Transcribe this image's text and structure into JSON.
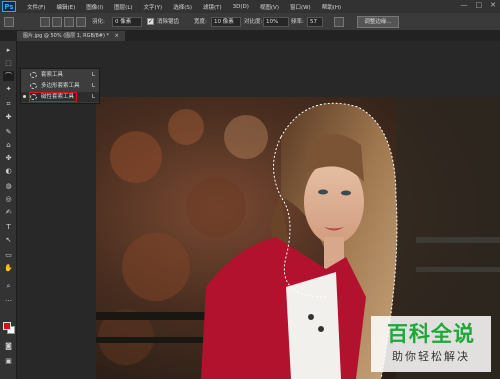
{
  "app": {
    "logo": "Ps"
  },
  "menu": [
    "文件(F)",
    "编辑(E)",
    "图像(I)",
    "图层(L)",
    "文字(Y)",
    "选择(S)",
    "滤镜(T)",
    "3D(D)",
    "视图(V)",
    "窗口(W)",
    "帮助(H)"
  ],
  "window_controls": {
    "minimize": "—",
    "maximize": "□",
    "close": "✕"
  },
  "options": {
    "feather_label": "羽化:",
    "feather_value": "0 像素",
    "antialias_label": "消除锯齿",
    "antialias_checked": true,
    "width_label": "宽度:",
    "width_value": "10 像素",
    "contrast_label": "对比度:",
    "contrast_value": "10%",
    "frequency_label": "频率:",
    "frequency_value": "57",
    "refine_edge_label": "调整边缘..."
  },
  "document_tab": {
    "label": "图片.jpg @ 50% (图层 1, RGB/8#) *",
    "close": "×"
  },
  "toolbar": {
    "tools": [
      "▸",
      "⬚",
      "⌒",
      "✦",
      "⌗",
      "✚",
      "✎",
      "⌂",
      "✤",
      "◐",
      "◍",
      "◎",
      "✍",
      "T",
      "↖",
      "▭",
      "✋",
      "⌕",
      "…"
    ],
    "foreground_color": "#d0121b",
    "background_color": "#ffffff"
  },
  "flyout": {
    "items": [
      {
        "label": "套索工具",
        "key": "L"
      },
      {
        "label": "多边形套索工具",
        "key": "L"
      },
      {
        "label": "磁性套索工具",
        "key": "L"
      }
    ]
  },
  "watermark": {
    "title": "百科全说",
    "subtitle": "助你轻松解决"
  }
}
